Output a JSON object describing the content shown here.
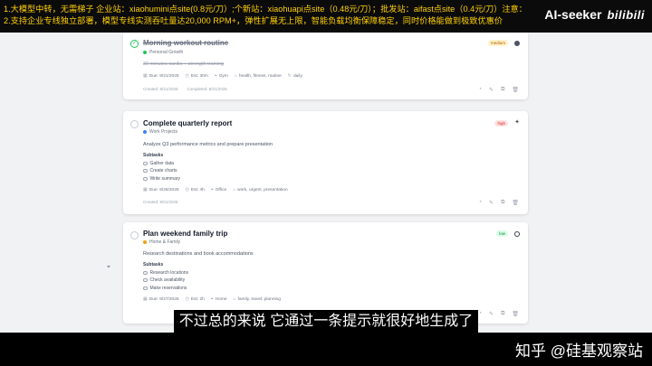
{
  "header": {
    "ad_line1": "1.大模型中转，无需梯子   企业站：xiaohumini点site(0.8元/刀）;个新站：xiaohuapi点site（0.48元/刀）；批发站：aifast点site（0.4元/刀）注意：将“点”换成“.”",
    "ad_line2": "2.支持企业专线独立部署，模型专线实测吞吐量达20,000 RPM+，弹性扩展无上限，智能负载均衡保障稳定，同时价格能做到极致优惠价",
    "brand_name": "AI-seeker",
    "brand_logo": "bilibili"
  },
  "footer": {
    "watermark": "知乎 @硅基观察站",
    "subtitle": "不过总的来说 它通过一条提示就很好地生成了"
  },
  "tasks": [
    {
      "title": "Morning workout routine",
      "category": "Personal Growth",
      "category_color": "#22c55e",
      "description": "30 minutes cardio + strength training",
      "priority": "medium",
      "due": "Due: 8/21/2025",
      "est": "Est: 30m",
      "location": "Gym",
      "tags": "health, fitness, routine",
      "recurrence": "daily",
      "created": "Created: 8/21/2025",
      "completed": "Completed: 8/21/2025",
      "subtasks_label": "",
      "subtasks": []
    },
    {
      "title": "Complete quarterly report",
      "category": "Work Projects",
      "category_color": "#3b82f6",
      "description": "Analyze Q3 performance metrics and prepare presentation",
      "priority": "high",
      "due": "Due: 8/28/2025",
      "est": "Est: 4h",
      "location": "Office",
      "tags": "work, urgent, presentation",
      "recurrence": "",
      "created": "Created: 8/21/2025",
      "completed": "",
      "subtasks_label": "Subtasks",
      "subtasks": [
        "Gather data",
        "Create charts",
        "Write summary"
      ]
    },
    {
      "title": "Plan weekend family trip",
      "category": "Home & Family",
      "category_color": "#f59e0b",
      "description": "Research destinations and book accommodations",
      "priority": "low",
      "due": "Due: 8/27/2025",
      "est": "Est: 2h",
      "location": "Home",
      "tags": "family, travel, planning",
      "recurrence": "",
      "created": "",
      "completed": "",
      "subtasks_label": "Subtasks",
      "subtasks": [
        "Research locations",
        "Check availability",
        "Make reservations"
      ]
    }
  ],
  "icons": {
    "calendar": "▦",
    "clock": "◷",
    "pin": "⌖",
    "tag": "⌂",
    "repeat": "↻",
    "timer": "◔",
    "edit": "✎",
    "copy": "⧉",
    "trash": "🗑",
    "check": "✓",
    "sparkle": "✦"
  }
}
